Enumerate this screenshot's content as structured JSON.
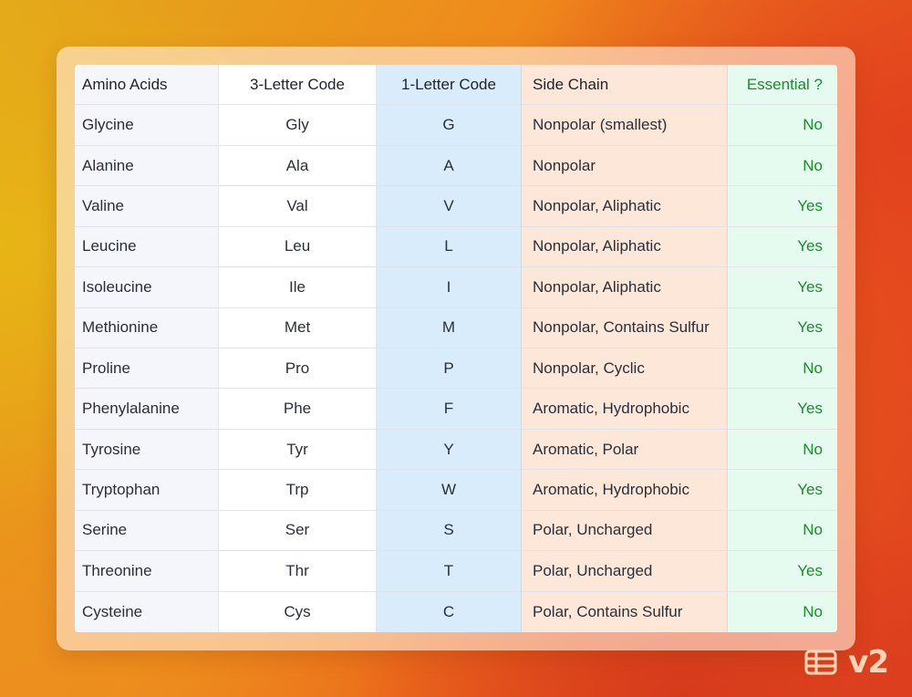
{
  "table": {
    "headers": [
      "Amino Acids",
      "3-Letter Code",
      "1-Letter Code",
      "Side Chain",
      "Essential ?"
    ],
    "rows": [
      [
        "Glycine",
        "Gly",
        "G",
        "Nonpolar (smallest)",
        "No"
      ],
      [
        "Alanine",
        "Ala",
        "A",
        "Nonpolar",
        "No"
      ],
      [
        "Valine",
        "Val",
        "V",
        "Nonpolar, Aliphatic",
        "Yes"
      ],
      [
        "Leucine",
        "Leu",
        "L",
        "Nonpolar, Aliphatic",
        "Yes"
      ],
      [
        "Isoleucine",
        "Ile",
        "I",
        "Nonpolar, Aliphatic",
        "Yes"
      ],
      [
        "Methionine",
        "Met",
        "M",
        "Nonpolar, Contains Sulfur",
        "Yes"
      ],
      [
        "Proline",
        "Pro",
        "P",
        "Nonpolar, Cyclic",
        "No"
      ],
      [
        "Phenylalanine",
        "Phe",
        "F",
        "Aromatic, Hydrophobic",
        "Yes"
      ],
      [
        "Tyrosine",
        "Tyr",
        "Y",
        "Aromatic, Polar",
        "No"
      ],
      [
        "Tryptophan",
        "Trp",
        "W",
        "Aromatic, Hydrophobic",
        "Yes"
      ],
      [
        "Serine",
        "Ser",
        "S",
        "Polar, Uncharged",
        "No"
      ],
      [
        "Threonine",
        "Thr",
        "T",
        "Polar, Uncharged",
        "Yes"
      ],
      [
        "Cysteine",
        "Cys",
        "C",
        "Polar, Contains Sulfur",
        "No"
      ]
    ]
  },
  "badge": {
    "icon": "table-icon",
    "version": "v2"
  },
  "colors": {
    "essential_text": "#1d8a2c",
    "column_one_letter_bg": "#d8ecfb",
    "column_side_chain_bg": "#fde7d9",
    "column_essential_bg": "#e6fbf0",
    "column_name_bg": "#f5f5fc"
  }
}
